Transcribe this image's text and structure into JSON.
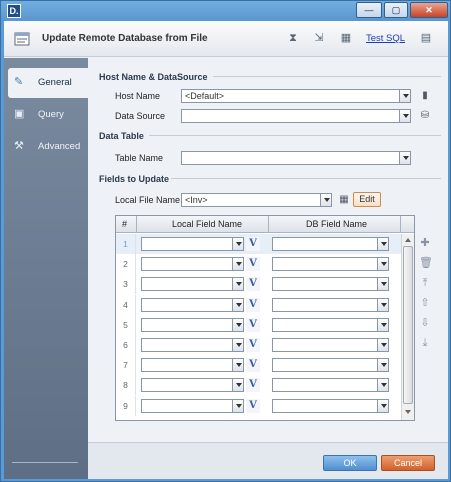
{
  "window": {
    "app_icon": "D.",
    "minimize_label": "—",
    "maximize_label": "▢",
    "close_label": "✕"
  },
  "header": {
    "title": "Update Remote Database from File",
    "test_sql_label": "Test SQL",
    "icons": [
      "hourglass-icon",
      "import-icon",
      "grid-icon",
      "notepad-icon"
    ]
  },
  "sidebar": {
    "items": [
      {
        "label": "General",
        "icon": "pencil-icon",
        "selected": true
      },
      {
        "label": "Query",
        "icon": "query-icon",
        "selected": false
      },
      {
        "label": "Advanced",
        "icon": "wrench-icon",
        "selected": false
      }
    ]
  },
  "host": {
    "section_label": "Host Name & DataSource",
    "host_name_label": "Host Name",
    "host_name_value": "<Default>",
    "data_source_label": "Data Source",
    "data_source_value": ""
  },
  "table": {
    "section_label": "Data Table",
    "table_name_label": "Table Name",
    "table_name_value": ""
  },
  "fields": {
    "section_label": "Fields to Update",
    "local_file_label": "Local File Name",
    "local_file_value": "<Inv>",
    "edit_label": "Edit",
    "columns": [
      "#",
      "Local Field Name",
      "DB Field Name"
    ],
    "v_label": "V",
    "rows": [
      "1",
      "2",
      "3",
      "4",
      "5",
      "6",
      "7",
      "8",
      "9"
    ]
  },
  "footer": {
    "ok_label": "OK",
    "cancel_label": "Cancel"
  },
  "colors": {
    "window_frame": "#5b9bd5",
    "sidebar": "#6c7c92",
    "ok_button": "#5b9bd5",
    "cancel_button": "#d8703a"
  }
}
